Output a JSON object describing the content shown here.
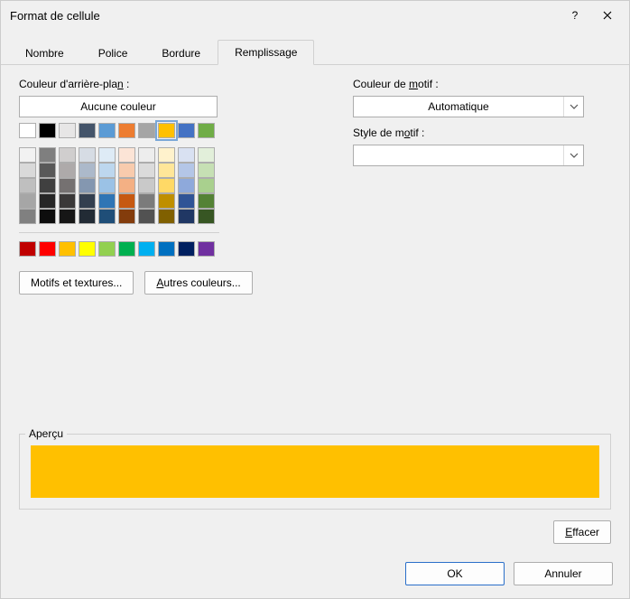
{
  "title": "Format de cellule",
  "titlebar": {
    "help": "?",
    "close": "✕"
  },
  "tabs": {
    "items": [
      "Nombre",
      "Police",
      "Bordure",
      "Remplissage"
    ],
    "active_index": 3
  },
  "left": {
    "bg_label_pre": "Couleur d'arrière-pla",
    "bg_label_u": "n",
    "bg_label_post": " :",
    "no_color": "Aucune couleur",
    "row_theme": [
      "#ffffff",
      "#000000",
      "#e7e6e6",
      "#44546a",
      "#5b9bd5",
      "#ed7d31",
      "#a5a5a5",
      "#ffc000",
      "#4472c4",
      "#70ad47"
    ],
    "selected_color": "#ffc000",
    "rows_tints": [
      [
        "#f2f2f2",
        "#7f7f7f",
        "#d0cece",
        "#d6dce4",
        "#deebf6",
        "#fce4d6",
        "#ededed",
        "#fff2cc",
        "#d9e1f2",
        "#e2efda"
      ],
      [
        "#d9d9d9",
        "#595959",
        "#aeaaaa",
        "#acb9ca",
        "#bdd7ee",
        "#f8cbad",
        "#dbdbdb",
        "#ffe699",
        "#b4c6e7",
        "#c6e0b4"
      ],
      [
        "#bfbfbf",
        "#404040",
        "#757171",
        "#8497b0",
        "#9bc2e6",
        "#f4b084",
        "#c9c9c9",
        "#ffd966",
        "#8ea9db",
        "#a9d08e"
      ],
      [
        "#a6a6a6",
        "#262626",
        "#3a3838",
        "#333f4f",
        "#2f75b5",
        "#c65911",
        "#7b7b7b",
        "#bf8f00",
        "#305496",
        "#548235"
      ],
      [
        "#808080",
        "#0d0d0d",
        "#161616",
        "#222b35",
        "#1f4e78",
        "#833c0c",
        "#525252",
        "#806000",
        "#203764",
        "#375623"
      ]
    ],
    "row_standard": [
      "#c00000",
      "#ff0000",
      "#ffc000",
      "#ffff00",
      "#92d050",
      "#00b050",
      "#00b0f0",
      "#0070c0",
      "#002060",
      "#7030a0"
    ],
    "fill_effects": "Motifs et textures...",
    "more_colors_pre": "",
    "more_colors_u": "A",
    "more_colors_post": "utres couleurs..."
  },
  "right": {
    "pattern_color_label_pre": "Couleur de ",
    "pattern_color_label_u": "m",
    "pattern_color_label_post": "otif :",
    "pattern_color_value": "Automatique",
    "pattern_style_label_pre": "Style de m",
    "pattern_style_label_u": "o",
    "pattern_style_label_post": "tif :",
    "pattern_style_value": ""
  },
  "preview": {
    "label": "Aperçu",
    "color": "#ffc000"
  },
  "clear_pre": "",
  "clear_u": "E",
  "clear_post": "ffacer",
  "footer": {
    "ok": "OK",
    "cancel": "Annuler"
  }
}
